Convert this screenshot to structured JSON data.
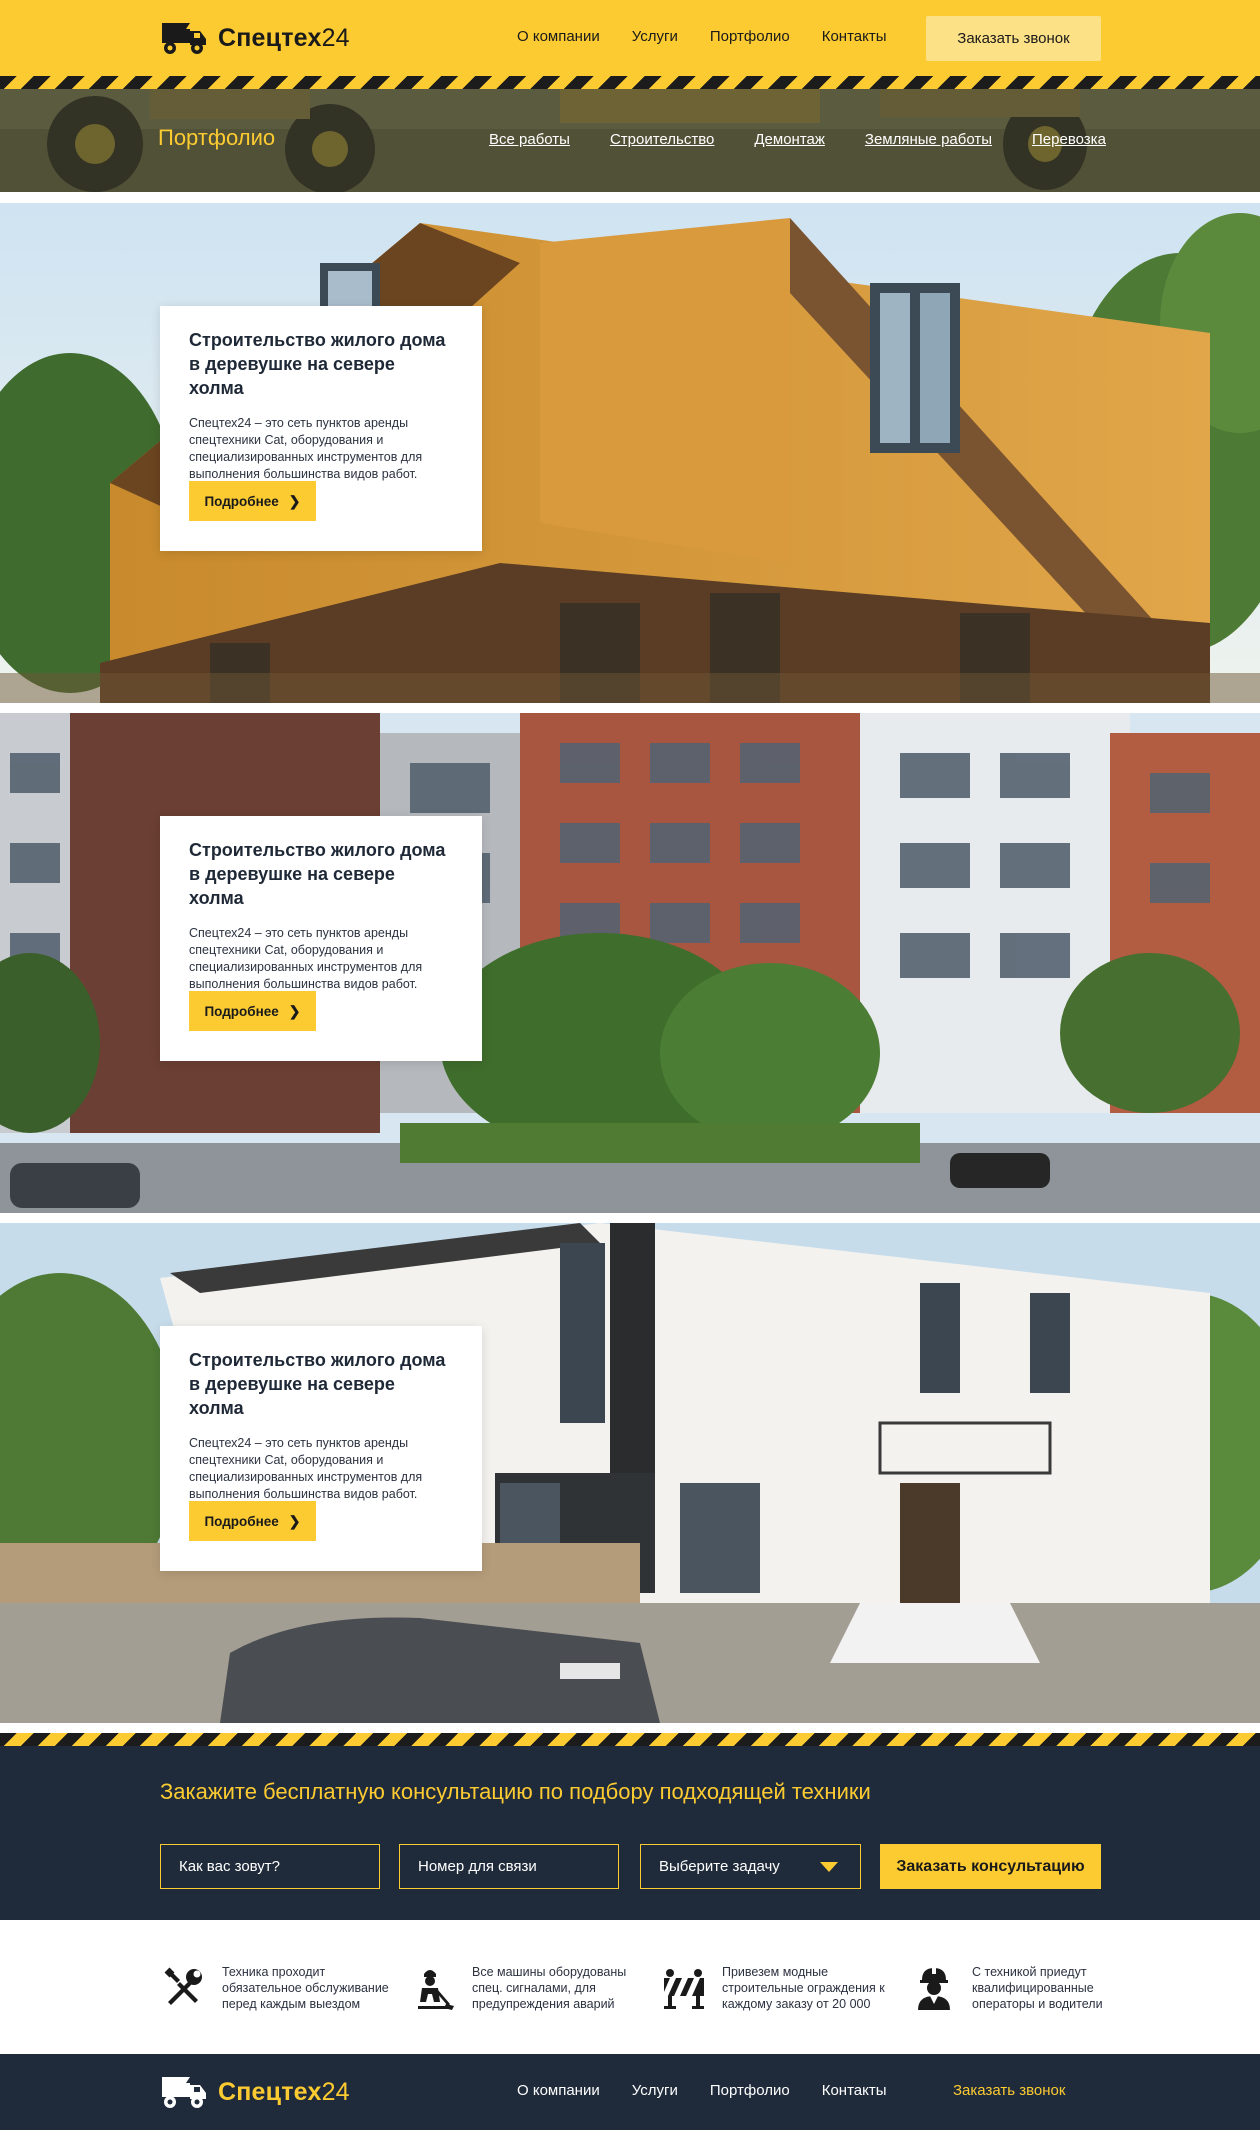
{
  "header": {
    "logo_bold": "Спецтех",
    "logo_num": "24",
    "nav": [
      "О компании",
      "Услуги",
      "Портфолио",
      "Контакты"
    ],
    "call_button": "Заказать звонок"
  },
  "portfolio": {
    "title": "Портфолио",
    "filters": [
      "Все работы",
      "Строительство",
      "Демонтаж",
      "Земляные работы",
      "Перевозка"
    ]
  },
  "projects": [
    {
      "title": "Строительство жилого дома в деревушке на севере холма",
      "text": "Спецтех24 – это сеть пунктов аренды спецтехники Cat, оборудования и специализированных инструментов для выполнения большинства видов работ.",
      "button": "Подробнее"
    },
    {
      "title": "Строительство жилого дома в деревушке на севере холма",
      "text": "Спецтех24 – это сеть пунктов аренды спецтехники Cat, оборудования и специализированных инструментов для выполнения большинства видов работ.",
      "button": "Подробнее"
    },
    {
      "title": "Строительство жилого дома в деревушке на севере холма",
      "text": "Спецтех24 – это сеть пунктов аренды спецтехники Cat, оборудования и специализированных инструментов для выполнения большинства видов работ.",
      "button": "Подробнее"
    }
  ],
  "consultation": {
    "title": "Закажите бесплатную консультацию по подбору подходящей техники",
    "name_placeholder": "Как вас зовут?",
    "phone_placeholder": "Номер для связи",
    "task_select": "Выберите задачу",
    "submit": "Заказать консультацию"
  },
  "features": [
    {
      "icon": "wrench-screwdriver-icon",
      "text": "Техника проходит обязательное обслуживание перед каждым выездом"
    },
    {
      "icon": "worker-shovel-icon",
      "text": "Все машины оборудованы спец. сигналами, для предупреждения аварий"
    },
    {
      "icon": "road-barrier-icon",
      "text": "Привезем модные строительные ограждения к каждому заказу от 20 000"
    },
    {
      "icon": "hard-hat-worker-icon",
      "text": "С техникой приедут квалифицированные операторы и водители"
    }
  ],
  "footer": {
    "logo_bold": "Спецтех",
    "logo_num": "24",
    "nav": [
      "О компании",
      "Услуги",
      "Портфолио",
      "Контакты"
    ],
    "call_link": "Заказать звонок"
  },
  "colors": {
    "accent": "#fccb32",
    "dark": "#1f2a3a",
    "button_light": "#fde187"
  }
}
